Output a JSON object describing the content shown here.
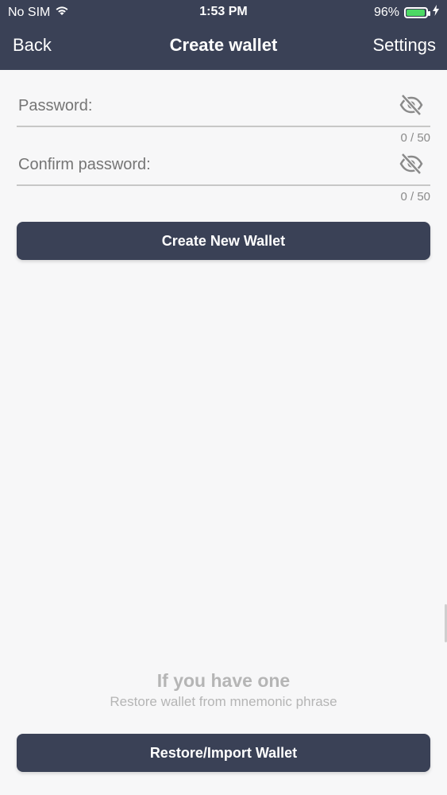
{
  "status_bar": {
    "carrier": "No SIM",
    "time": "1:53 PM",
    "battery_percent": "96%",
    "battery_level": 0.96,
    "wifi_icon": "wifi-icon",
    "charging_icon": "bolt-icon"
  },
  "nav": {
    "back_label": "Back",
    "title": "Create wallet",
    "settings_label": "Settings"
  },
  "form": {
    "password": {
      "placeholder": "Password:",
      "value": "",
      "counter": "0 / 50",
      "toggle_icon": "eye-off-icon"
    },
    "confirm_password": {
      "placeholder": "Confirm password:",
      "value": "",
      "counter": "0 / 50",
      "toggle_icon": "eye-off-icon"
    },
    "create_button_label": "Create New Wallet"
  },
  "restore": {
    "heading": "If you have one",
    "subtitle": "Restore wallet from mnemonic phrase",
    "button_label": "Restore/Import Wallet"
  },
  "colors": {
    "header_bg": "#3a4156",
    "button_bg": "#3a4156",
    "page_bg": "#f7f7f8",
    "muted_text": "#b5b5b5"
  }
}
